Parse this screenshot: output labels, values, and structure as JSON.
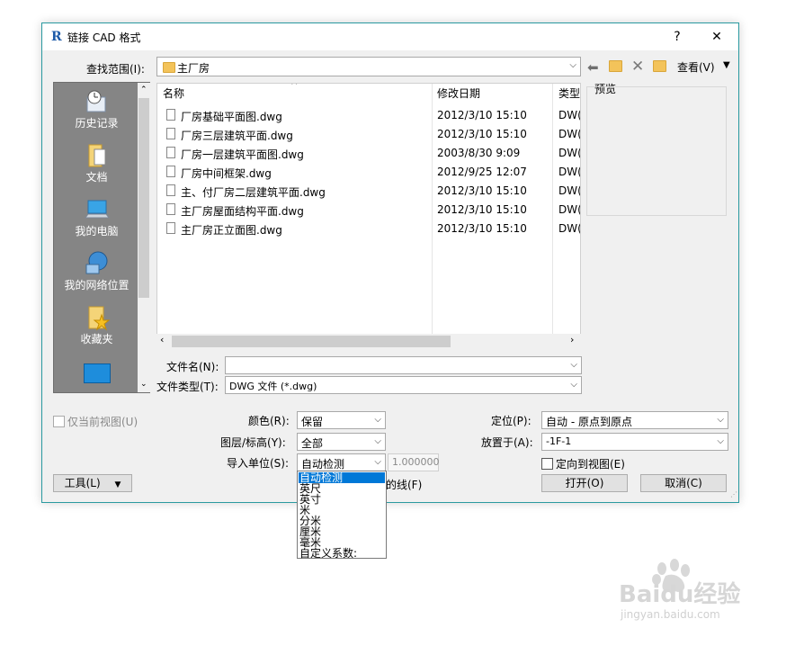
{
  "window": {
    "title": "链接 CAD 格式",
    "help": "?",
    "close": "✕",
    "accent_border": "#2a9aa0"
  },
  "lookin": {
    "label": "查找范围(I):",
    "value": "主厂房",
    "view_label": "查看(V)"
  },
  "places": [
    {
      "label": "历史记录",
      "icon": "history-icon"
    },
    {
      "label": "文档",
      "icon": "documents-icon"
    },
    {
      "label": "我的电脑",
      "icon": "computer-icon"
    },
    {
      "label": "我的网络位置",
      "icon": "network-icon"
    },
    {
      "label": "收藏夹",
      "icon": "favorites-icon"
    }
  ],
  "filelist": {
    "headers": {
      "name": "名称",
      "date": "修改日期",
      "type": "类型"
    },
    "files": [
      {
        "name": "厂房基础平面图.dwg",
        "date": "2012/3/10 15:10",
        "type": "DW("
      },
      {
        "name": "厂房三层建筑平面.dwg",
        "date": "2012/3/10 15:10",
        "type": "DW("
      },
      {
        "name": "厂房一层建筑平面图.dwg",
        "date": "2003/8/30 9:09",
        "type": "DW("
      },
      {
        "name": "厂房中间框架.dwg",
        "date": "2012/9/25 12:07",
        "type": "DW("
      },
      {
        "name": "主、付厂房二层建筑平面.dwg",
        "date": "2012/3/10 15:10",
        "type": "DW("
      },
      {
        "name": "主厂房屋面结构平面.dwg",
        "date": "2012/3/10 15:10",
        "type": "DW("
      },
      {
        "name": "主厂房正立面图.dwg",
        "date": "2012/3/10 15:10",
        "type": "DW("
      }
    ]
  },
  "preview": {
    "label": "预览"
  },
  "filename": {
    "label": "文件名(N):",
    "value": ""
  },
  "filetype": {
    "label": "文件类型(T):",
    "value": "DWG 文件 (*.dwg)"
  },
  "options": {
    "current_view_label": "仅当前视图(U)",
    "color_label": "颜色(R):",
    "color_value": "保留",
    "layers_label": "图层/标高(Y):",
    "layers_value": "全部",
    "units_label": "导入单位(S):",
    "units_value": "自动检测",
    "units_factor": "1.000000",
    "position_label": "定位(P):",
    "position_value": "自动 - 原点到原点",
    "place_label": "放置于(A):",
    "place_value": "-1F-1",
    "orient_label": "定向到视图(E)",
    "lines_label": "的线(F)"
  },
  "units_options": [
    "自动检测",
    "英尺",
    "英寸",
    "米",
    "分米",
    "厘米",
    "毫米",
    "自定义系数:"
  ],
  "units_selected_color": "#0078d7",
  "buttons": {
    "tools": "工具(L)",
    "open": "打开(O)",
    "cancel": "取消(C)"
  },
  "watermark": {
    "brand": "Baidu经验",
    "url": "jingyan.baidu.com"
  }
}
